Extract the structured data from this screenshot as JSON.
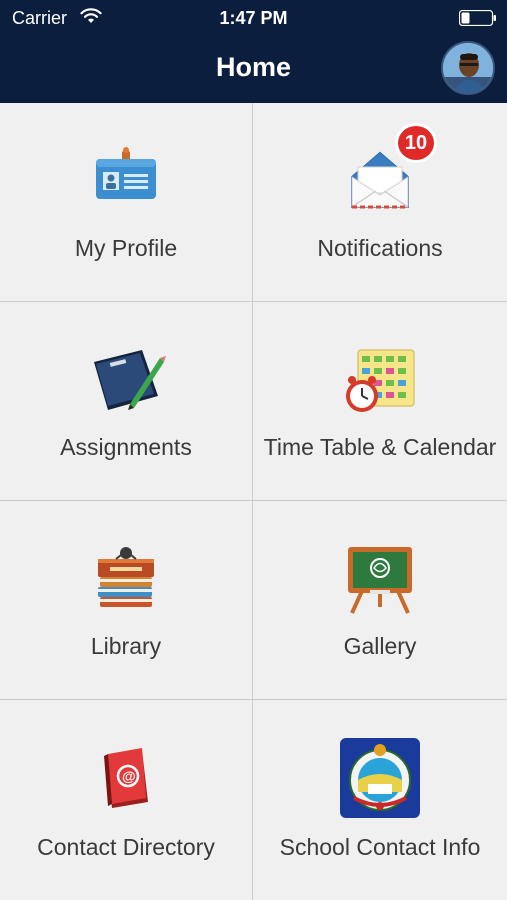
{
  "status_bar": {
    "carrier": "Carrier",
    "time": "1:47 PM",
    "wifi_icon": "wifi-icon",
    "battery_icon": "battery-icon"
  },
  "header": {
    "title": "Home",
    "avatar_icon": "user-avatar",
    "background_color": "#0b1e3d"
  },
  "tiles": [
    {
      "label": "My Profile",
      "icon": "id-card-icon"
    },
    {
      "label": "Notifications",
      "icon": "envelope-icon",
      "badge": "10"
    },
    {
      "label": "Assignments",
      "icon": "notebook-pencil-icon"
    },
    {
      "label": "Time Table & Calendar",
      "icon": "calendar-clock-icon"
    },
    {
      "label": "Library",
      "icon": "books-stack-icon"
    },
    {
      "label": "Gallery",
      "icon": "easel-board-icon"
    },
    {
      "label": "Contact Directory",
      "icon": "address-book-icon"
    },
    {
      "label": "School Contact Info",
      "icon": "school-emblem-icon"
    }
  ],
  "colors": {
    "tile_background": "#f0f0f0",
    "divider": "#cbcbcb",
    "label_text": "#3a3a3a",
    "badge": "#e02a2a"
  }
}
